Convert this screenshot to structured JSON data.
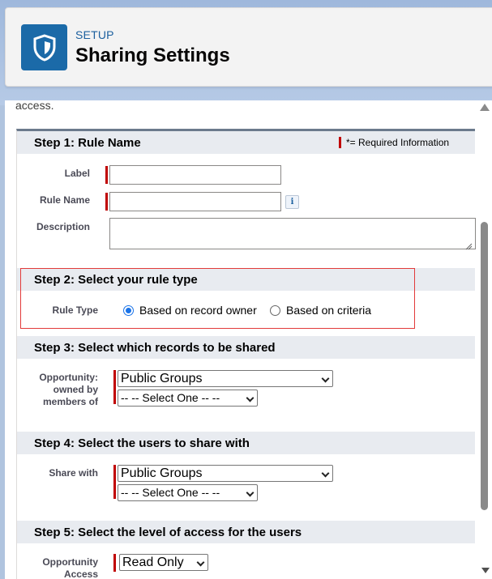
{
  "header": {
    "setup_label": "SETUP",
    "title": "Sharing Settings",
    "icon": "shield-icon"
  },
  "content": {
    "intro_fragment": "access."
  },
  "required_info": "*= Required Information",
  "step1": {
    "title": "Step 1: Rule Name",
    "label_label": "Label",
    "label_value": "",
    "rule_name_label": "Rule Name",
    "rule_name_value": "",
    "info_icon": "i",
    "description_label": "Description",
    "description_value": ""
  },
  "step2": {
    "title": "Step 2: Select your rule type",
    "rule_type_label": "Rule Type",
    "options": [
      "Based on record owner",
      "Based on criteria"
    ],
    "selected": "Based on record owner"
  },
  "step3": {
    "title": "Step 3: Select which records to be shared",
    "label_line1": "Opportunity:",
    "label_line2": "owned by",
    "label_line3": "members of",
    "group_type": "Public Groups",
    "group_value": "-- -- Select One -- --"
  },
  "step4": {
    "title": "Step 4: Select the users to share with",
    "share_with_label": "Share with",
    "group_type": "Public Groups",
    "group_value": "-- -- Select One -- --"
  },
  "step5": {
    "title": "Step 5: Select the level of access for the users",
    "label_line1": "Opportunity",
    "label_line2": "Access",
    "access_value": "Read Only"
  },
  "colors": {
    "brand_blue": "#1b6aa8",
    "required_red": "#c00000",
    "highlight_red": "#e23a3a",
    "step_bar": "#e8ebf0"
  }
}
